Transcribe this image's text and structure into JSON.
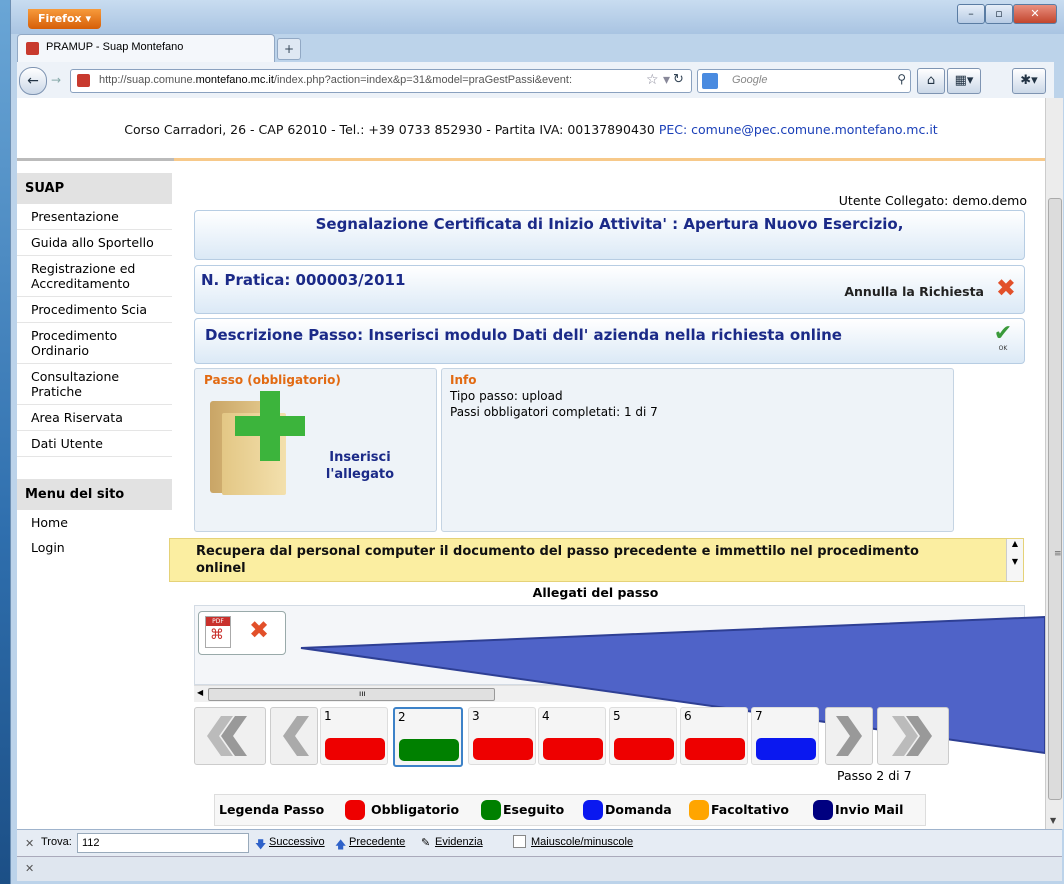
{
  "browser": {
    "menu_button": "Firefox ▾",
    "tab_title": "PRAMUP - Suap Montefano",
    "url_prefix": "http://suap.comune.",
    "url_domain": "montefano.mc.it",
    "url_suffix": "/index.php?action=index&p=31&model=praGestPassi&event:",
    "search_placeholder": "Google"
  },
  "header": {
    "address_text": "Corso Carradori, 26 - CAP 62010 - Tel.: +39 0733 852930 - Partita IVA: 00137890430",
    "pec": "PEC: comune@pec.comune.montefano.mc.it"
  },
  "sidebar": {
    "suap_title": "SUAP",
    "items": [
      {
        "label": "Presentazione"
      },
      {
        "label": "Guida allo Sportello"
      },
      {
        "label": "Registrazione ed Accreditamento"
      },
      {
        "label": "Procedimento Scia"
      },
      {
        "label": "Procedimento Ordinario"
      },
      {
        "label": "Consultazione Pratiche"
      },
      {
        "label": "Area Riservata"
      },
      {
        "label": "Dati Utente"
      }
    ],
    "menu_title": "Menu del sito",
    "menu_items": [
      {
        "label": "Home"
      },
      {
        "label": "Login"
      }
    ]
  },
  "main": {
    "utente": "Utente Collegato: demo.demo",
    "title": "Segnalazione Certificata di Inizio Attivita' : Apertura Nuovo Esercizio,",
    "pratica": "N. Pratica: 000003/2011",
    "annulla": "Annulla la Richiesta",
    "descrizione": "Descrizione Passo: Inserisci modulo Dati dell' azienda nella richiesta online",
    "ok_label": "OK",
    "passo_title": "Passo (obbligatorio)",
    "inserisci": "Inserisci l'allegato",
    "info_title": "Info",
    "tipo_passo": "Tipo passo: upload",
    "passi_completati": "Passi obbligatori completati: 1 di 7",
    "hint": "Recupera dal personal computer il documento del passo precedente e immettilo nel procedimento onlinel",
    "allegati_title": "Allegati del passo",
    "pdf_label": "PDF"
  },
  "steps": {
    "items": [
      {
        "n": "1",
        "color": "#ee0000"
      },
      {
        "n": "2",
        "color": "#008000"
      },
      {
        "n": "3",
        "color": "#ee0000"
      },
      {
        "n": "4",
        "color": "#ee0000"
      },
      {
        "n": "5",
        "color": "#ee0000"
      },
      {
        "n": "6",
        "color": "#ee0000"
      },
      {
        "n": "7",
        "color": "#0a18f0"
      }
    ],
    "selected": "2",
    "count_text": "Passo 2 di 7"
  },
  "legend": {
    "title": "Legenda Passo",
    "items": [
      {
        "label": "Obbligatorio",
        "color": "#ee0000"
      },
      {
        "label": "Eseguito",
        "color": "#008000"
      },
      {
        "label": "Domanda",
        "color": "#0a18f0"
      },
      {
        "label": "Facoltativo",
        "color": "#ffa500"
      },
      {
        "label": "Invio Mail",
        "color": "#000080"
      }
    ]
  },
  "findbar": {
    "label": "Trova:",
    "value": "112",
    "next": "Successivo",
    "prev": "Precedente",
    "highlight": "Evidenzia",
    "match_case": "Maiuscole/minuscole"
  }
}
